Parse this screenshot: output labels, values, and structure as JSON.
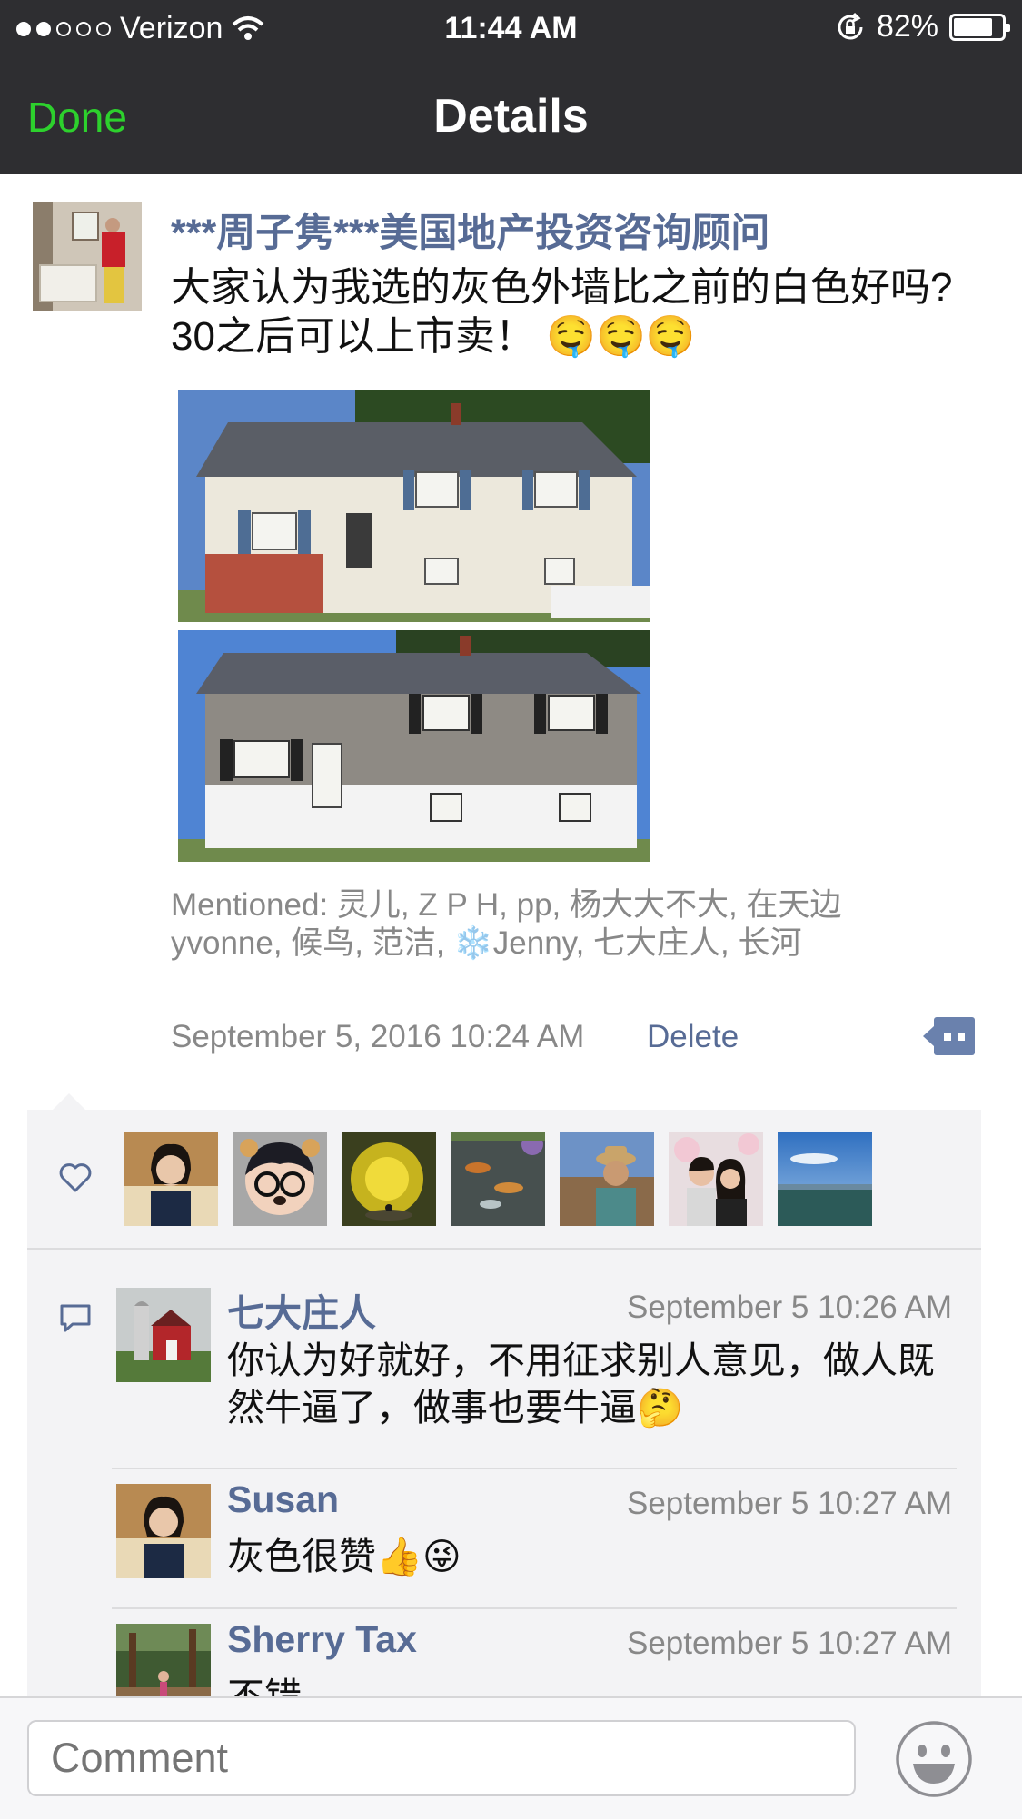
{
  "status_bar": {
    "carrier": "Verizon",
    "time": "11:44 AM",
    "battery_text": "82%",
    "battery_level": 0.82,
    "signal_bars": 2
  },
  "nav": {
    "done_label": "Done",
    "title": "Details"
  },
  "post": {
    "author": "***周子隽***美国地产投资咨询顾问",
    "text": "大家认为我选的灰色外墙比之前的白色好吗?30之后可以上市卖！ 🤤🤤🤤",
    "mentioned": "Mentioned: 灵儿, Z P H, pp, 杨大大不大, 在天边yvonne, 候鸟, 范洁, ❄️Jenny, 七大庄人, 长河",
    "timestamp": "September 5, 2016 10:24 AM",
    "delete_label": "Delete",
    "photo_count": 2
  },
  "likes": {
    "count_shown": 7
  },
  "comments": [
    {
      "name": "七大庄人",
      "time": "September 5 10:26 AM",
      "text": "你认为好就好，不用征求别人意见，做人既然牛逼了，做事也要牛逼🤔"
    },
    {
      "name": "Susan",
      "time": "September 5 10:27 AM",
      "text": "灰色很赞👍😜"
    },
    {
      "name": "Sherry Tax",
      "time": "September 5 10:27 AM",
      "text": "不错"
    }
  ],
  "comment_bar": {
    "placeholder": "Comment"
  },
  "colors": {
    "nav_bg": "#2e2e31",
    "accent_green": "#2dd12d",
    "link_blue": "#576b95",
    "feedback_bg": "#f3f3f5"
  }
}
